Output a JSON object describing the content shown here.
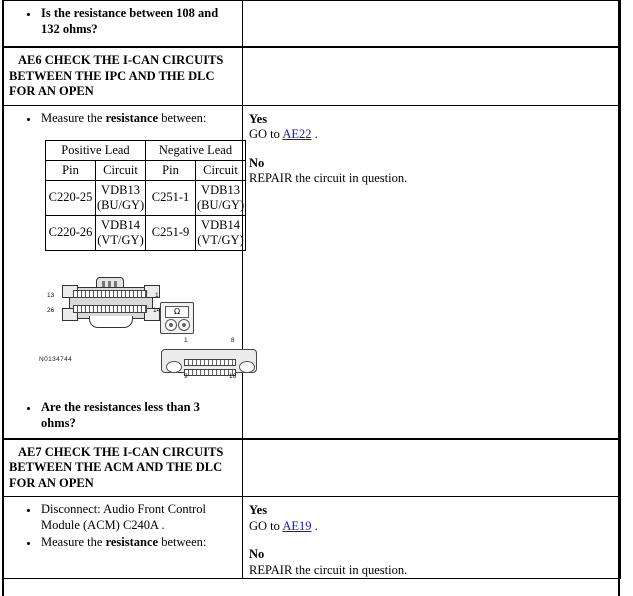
{
  "document": {
    "type": "pinpoint-test-procedure"
  },
  "blocks": [
    {
      "id": "prev-question",
      "question": "Is the resistance between 108 and 132 ohms?"
    },
    {
      "id": "AE6",
      "header": "AE6 CHECK THE I-CAN CIRCUITS BETWEEN THE IPC AND THE DLC FOR AN OPEN",
      "steps": [
        {
          "pre": "Measure the ",
          "bold": "resistance",
          "post": " between:"
        }
      ],
      "meas_table": {
        "group_headers": [
          "Positive Lead",
          "Negative Lead"
        ],
        "sub_headers": [
          "Pin",
          "Circuit",
          "Pin",
          "Circuit"
        ],
        "rows": [
          [
            "C220-25",
            "VDB13 (BU/GY)",
            "C251-1",
            "VDB13 (BU/GY)"
          ],
          [
            "C220-26",
            "VDB14 (VT/GY)",
            "C251-9",
            "VDB14 (VT/GY)"
          ]
        ]
      },
      "figure": {
        "id_label": "N0134744",
        "connector_26pin": {
          "labels": {
            "top_left": "13",
            "bottom_left": "26",
            "top_right": "1",
            "bottom_right": "14"
          }
        },
        "meter": {
          "display": "Ω"
        },
        "connector_dlc": {
          "labels": {
            "top_left": "1",
            "top_right": "8",
            "bottom_left": "9",
            "bottom_right": "16"
          }
        }
      },
      "question": "Are the resistances less than 3 ohms?",
      "answers": {
        "yes_label": "Yes",
        "yes_pre": "GO to ",
        "yes_link": "AE22",
        "yes_post": " .",
        "no_label": "No",
        "no_text": "REPAIR the circuit in question."
      }
    },
    {
      "id": "AE7",
      "header": "AE7 CHECK THE I-CAN CIRCUITS BETWEEN THE ACM AND THE DLC FOR AN OPEN",
      "steps": [
        {
          "text": "Disconnect: Audio Front Control Module (ACM) C240A ."
        },
        {
          "pre": "Measure the ",
          "bold": "resistance",
          "post": " between:"
        }
      ],
      "answers": {
        "yes_label": "Yes",
        "yes_pre": "GO to ",
        "yes_link": "AE19",
        "yes_post": " .",
        "no_label": "No",
        "no_text": "REPAIR the circuit in question."
      }
    }
  ],
  "colors": {
    "link": "#1414CC",
    "connector_body": "#D9D9D9",
    "rule": "#000000"
  }
}
